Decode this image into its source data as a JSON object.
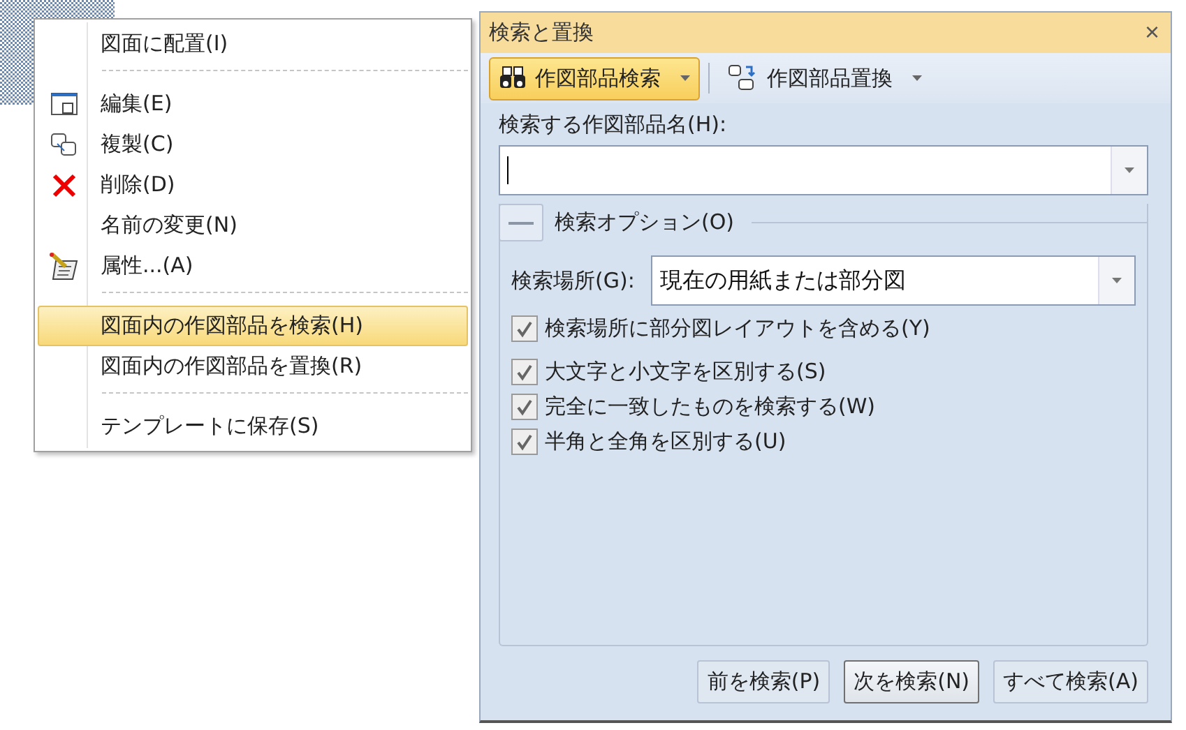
{
  "context_menu": {
    "items": [
      {
        "kind": "item",
        "label": "図面に配置(I)",
        "selected": false
      },
      {
        "kind": "separator"
      },
      {
        "kind": "item",
        "label": "編集(E)",
        "selected": false
      },
      {
        "kind": "item",
        "label": "複製(C)",
        "selected": false
      },
      {
        "kind": "item",
        "label": "削除(D)",
        "selected": false
      },
      {
        "kind": "item",
        "label": "名前の変更(N)",
        "selected": false
      },
      {
        "kind": "item",
        "label": "属性...(A)",
        "selected": false
      },
      {
        "kind": "separator"
      },
      {
        "kind": "item",
        "label": "図面内の作図部品を検索(H)",
        "selected": true
      },
      {
        "kind": "item",
        "label": "図面内の作図部品を置換(R)",
        "selected": false
      },
      {
        "kind": "separator"
      },
      {
        "kind": "item",
        "label": "テンプレートに保存(S)",
        "selected": false
      }
    ]
  },
  "dialog": {
    "title": "検索と置換",
    "close": "×",
    "tabs": [
      {
        "label": "作図部品検索",
        "selected": true
      },
      {
        "label": "作図部品置換",
        "selected": false
      }
    ],
    "name_label": "検索する作図部品名(H):",
    "options_title": "検索オプション(O)",
    "options_expanded": true,
    "location_label": "検索場所(G):",
    "location_value": "現在の用紙または部分図",
    "checkboxes": [
      {
        "label": "検索場所に部分図レイアウトを含める(Y)",
        "checked": true
      },
      {
        "label": "大文字と小文字を区別する(S)",
        "checked": true
      },
      {
        "label": "完全に一致したものを検索する(W)",
        "checked": true
      },
      {
        "label": "半角と全角を区別する(U)",
        "checked": true
      }
    ],
    "buttons": [
      {
        "label": "前を検索(P)",
        "default": false
      },
      {
        "label": "次を検索(N)",
        "default": true
      },
      {
        "label": "すべて検索(A)",
        "default": false
      }
    ]
  }
}
